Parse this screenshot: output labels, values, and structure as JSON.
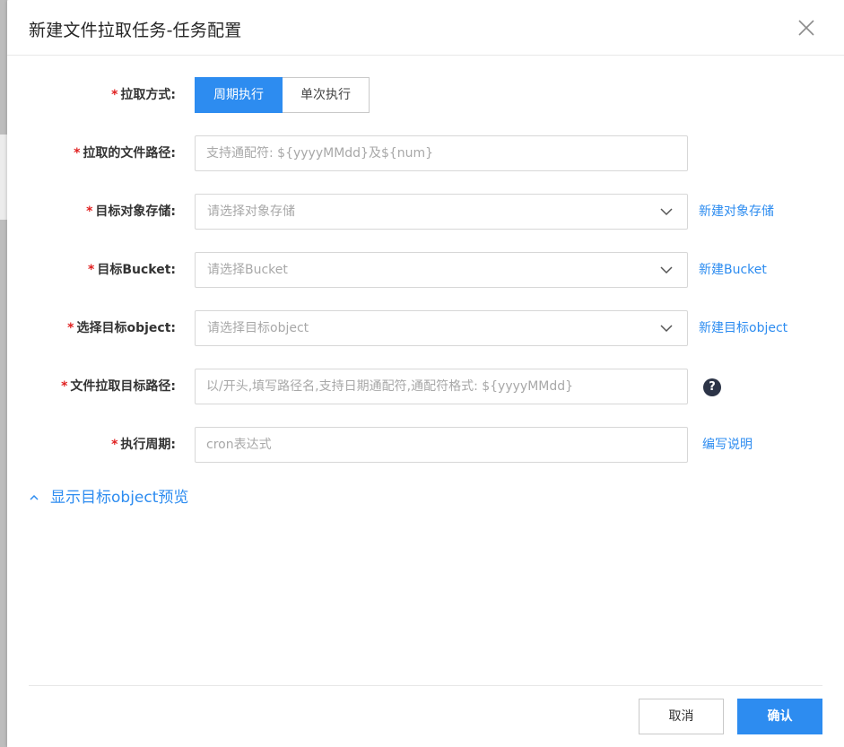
{
  "dialog": {
    "title": "新建文件拉取任务-任务配置"
  },
  "form": {
    "pull_mode": {
      "label": "拉取方式:",
      "options": [
        "周期执行",
        "单次执行"
      ],
      "selected": "周期执行"
    },
    "file_path": {
      "label": "拉取的文件路径:",
      "placeholder": "支持通配符: ${yyyyMMdd}及${num}"
    },
    "target_storage": {
      "label": "目标对象存储:",
      "placeholder": "请选择对象存储",
      "link": "新建对象存储"
    },
    "target_bucket": {
      "label": "目标Bucket:",
      "placeholder": "请选择Bucket",
      "link": "新建Bucket"
    },
    "target_object": {
      "label": "选择目标object:",
      "placeholder": "请选择目标object",
      "link": "新建目标object"
    },
    "target_path": {
      "label": "文件拉取目标路径:",
      "placeholder": "以/开头,填写路径名,支持日期通配符,通配符格式: ${yyyyMMdd}",
      "help": "?"
    },
    "schedule": {
      "label": "执行周期:",
      "placeholder": "cron表达式",
      "link": "编写说明"
    },
    "preview_toggle": "显示目标object预览"
  },
  "footer": {
    "cancel_label": "取消",
    "confirm_label": "确认"
  },
  "colors": {
    "primary": "#2d8cf0",
    "required": "#e02020",
    "help_icon": "#2c3447"
  }
}
